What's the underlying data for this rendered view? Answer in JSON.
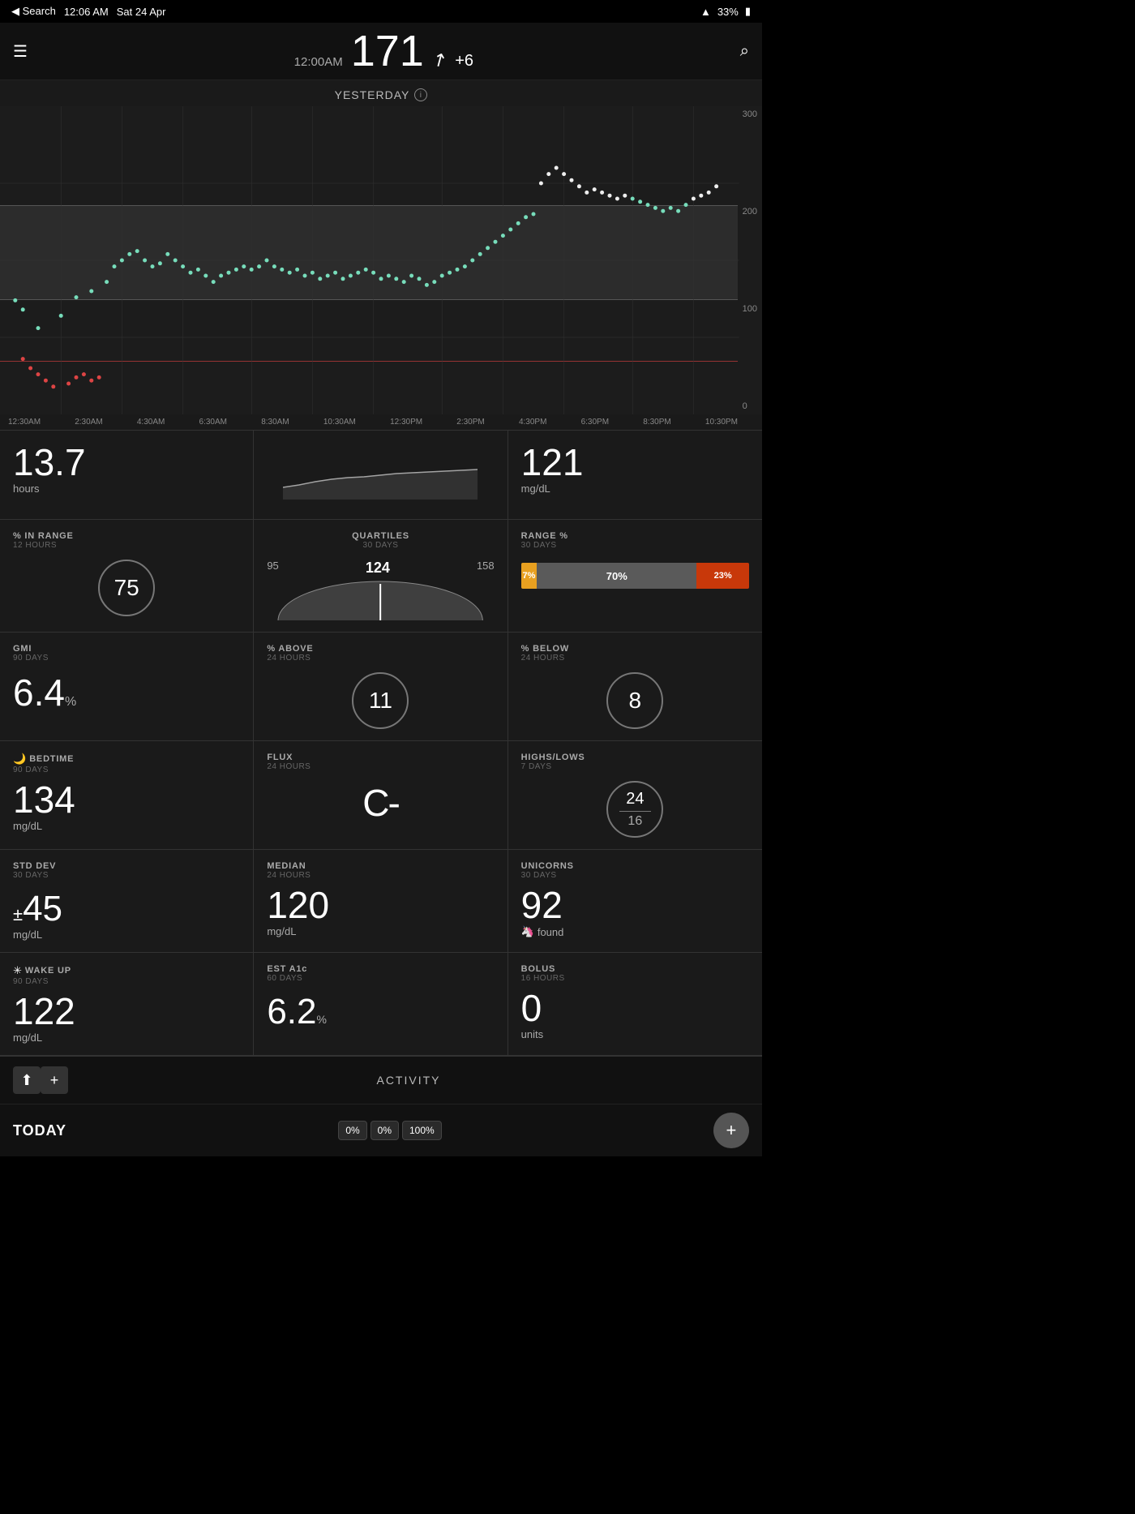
{
  "statusBar": {
    "search": "◀ Search",
    "time": "12:06 AM",
    "date": "Sat 24 Apr",
    "wifi": "wifi",
    "battery": "33%"
  },
  "header": {
    "menuIcon": "☰",
    "time": "12:00AM",
    "value": "171",
    "arrow": "↗",
    "delta": "+6",
    "searchIcon": "🔍"
  },
  "chart": {
    "title": "YESTERDAY",
    "yLabels": [
      "300",
      "200",
      "100",
      "0"
    ],
    "xLabels": [
      "12:30AM",
      "2:30AM",
      "4:30AM",
      "6:30AM",
      "8:30AM",
      "10:30AM",
      "12:30PM",
      "2:30PM",
      "4:30PM",
      "6:30PM",
      "8:30PM",
      "10:30PM"
    ]
  },
  "stats": {
    "hours": {
      "value": "13.7",
      "unit": "hours"
    },
    "mgdl": {
      "value": "121",
      "unit": "mg/dL"
    },
    "inRange": {
      "label": "% IN RANGE",
      "sublabel": "12 HOURS",
      "value": "75"
    },
    "quartiles": {
      "label": "QUARTILES",
      "sublabel": "30 DAYS",
      "low": "95",
      "median": "124",
      "high": "158"
    },
    "rangePercent": {
      "label": "RANGE %",
      "sublabel": "30 DAYS",
      "below": "7%",
      "inRange": "70%",
      "above": "23%"
    },
    "gmi": {
      "label": "GMI",
      "sublabel": "90 DAYS",
      "value": "6.4",
      "unit": "%"
    },
    "pctAbove": {
      "label": "% ABOVE",
      "sublabel": "24 HOURS",
      "value": "11"
    },
    "pctBelow": {
      "label": "% BELOW",
      "sublabel": "24 HOURS",
      "value": "8"
    },
    "bedtime": {
      "label": "BEDTIME",
      "sublabel": "90 DAYS",
      "value": "134",
      "unit": "mg/dL"
    },
    "flux": {
      "label": "FLUX",
      "sublabel": "24 HOURS",
      "value": "C-"
    },
    "highsLows": {
      "label": "HIGHS/LOWS",
      "sublabel": "7 DAYS",
      "highs": "24",
      "lows": "16"
    },
    "stdDev": {
      "label": "STD DEV",
      "sublabel": "30 DAYS",
      "prefix": "±",
      "value": "45",
      "unit": "mg/dL"
    },
    "median": {
      "label": "MEDIAN",
      "sublabel": "24 HOURS",
      "value": "120",
      "unit": "mg/dL"
    },
    "unicorns": {
      "label": "UNICORNS",
      "sublabel": "30 DAYS",
      "value": "92",
      "unit": "found",
      "icon": "🦄"
    },
    "wakeUp": {
      "label": "WAKE UP",
      "sublabel": "90 DAYS",
      "value": "122",
      "unit": "mg/dL"
    },
    "estA1c": {
      "label": "EST A1c",
      "sublabel": "60 DAYS",
      "value": "6.2",
      "unit": "%"
    },
    "bolus": {
      "label": "BOLUS",
      "sublabel": "16 HOURS",
      "value": "0",
      "unit": "units"
    }
  },
  "bottomBar": {
    "upIcon": "⬆",
    "plusIcon": "+",
    "activityLabel": "ACTIVITY"
  },
  "todayBar": {
    "label": "TODAY",
    "pct1": "0%",
    "pct2": "0%",
    "pct3": "100%",
    "fabIcon": "+"
  }
}
